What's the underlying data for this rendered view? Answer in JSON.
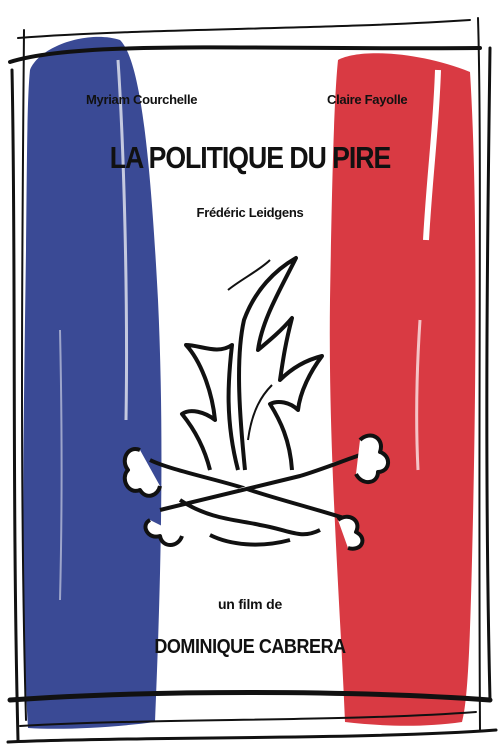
{
  "poster": {
    "actor_left": "Myriam Courchelle",
    "actor_right": "Claire Fayolle",
    "title": "LA POLITIQUE DU PIRE",
    "actor_center": "Frédéric Leidgens",
    "credit_intro": "un film de",
    "director": "DOMINIQUE CABRERA"
  },
  "colors": {
    "blue": "#3a4a95",
    "white": "#ffffff",
    "red": "#d93a43",
    "ink": "#111111"
  },
  "icons": [
    "flame-icon",
    "crossed-bones-icon"
  ]
}
